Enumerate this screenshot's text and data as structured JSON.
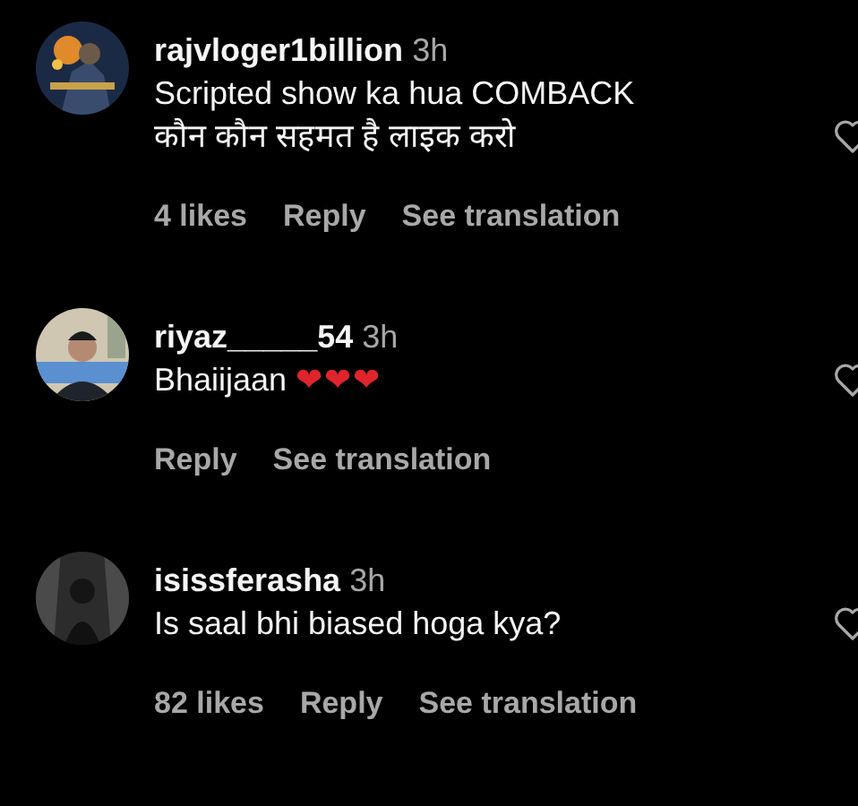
{
  "comments": [
    {
      "username": "rajvloger1billion",
      "time": "3h",
      "lines": [
        "Scripted show ka hua COMBACK",
        "कौन कौन सहमत है लाइक करो"
      ],
      "likes": "4 likes",
      "actions": [
        "Reply",
        "See translation"
      ]
    },
    {
      "username": "riyaz_____54",
      "time": "3h",
      "lines": [
        "Bhaiijaan"
      ],
      "emoji": "❤❤❤",
      "actions": [
        "Reply",
        "See translation"
      ]
    },
    {
      "username": "isissferasha",
      "time": "3h",
      "lines": [
        "Is saal bhi biased hoga kya?"
      ],
      "likes": "82 likes",
      "actions": [
        "Reply",
        "See translation"
      ]
    }
  ]
}
